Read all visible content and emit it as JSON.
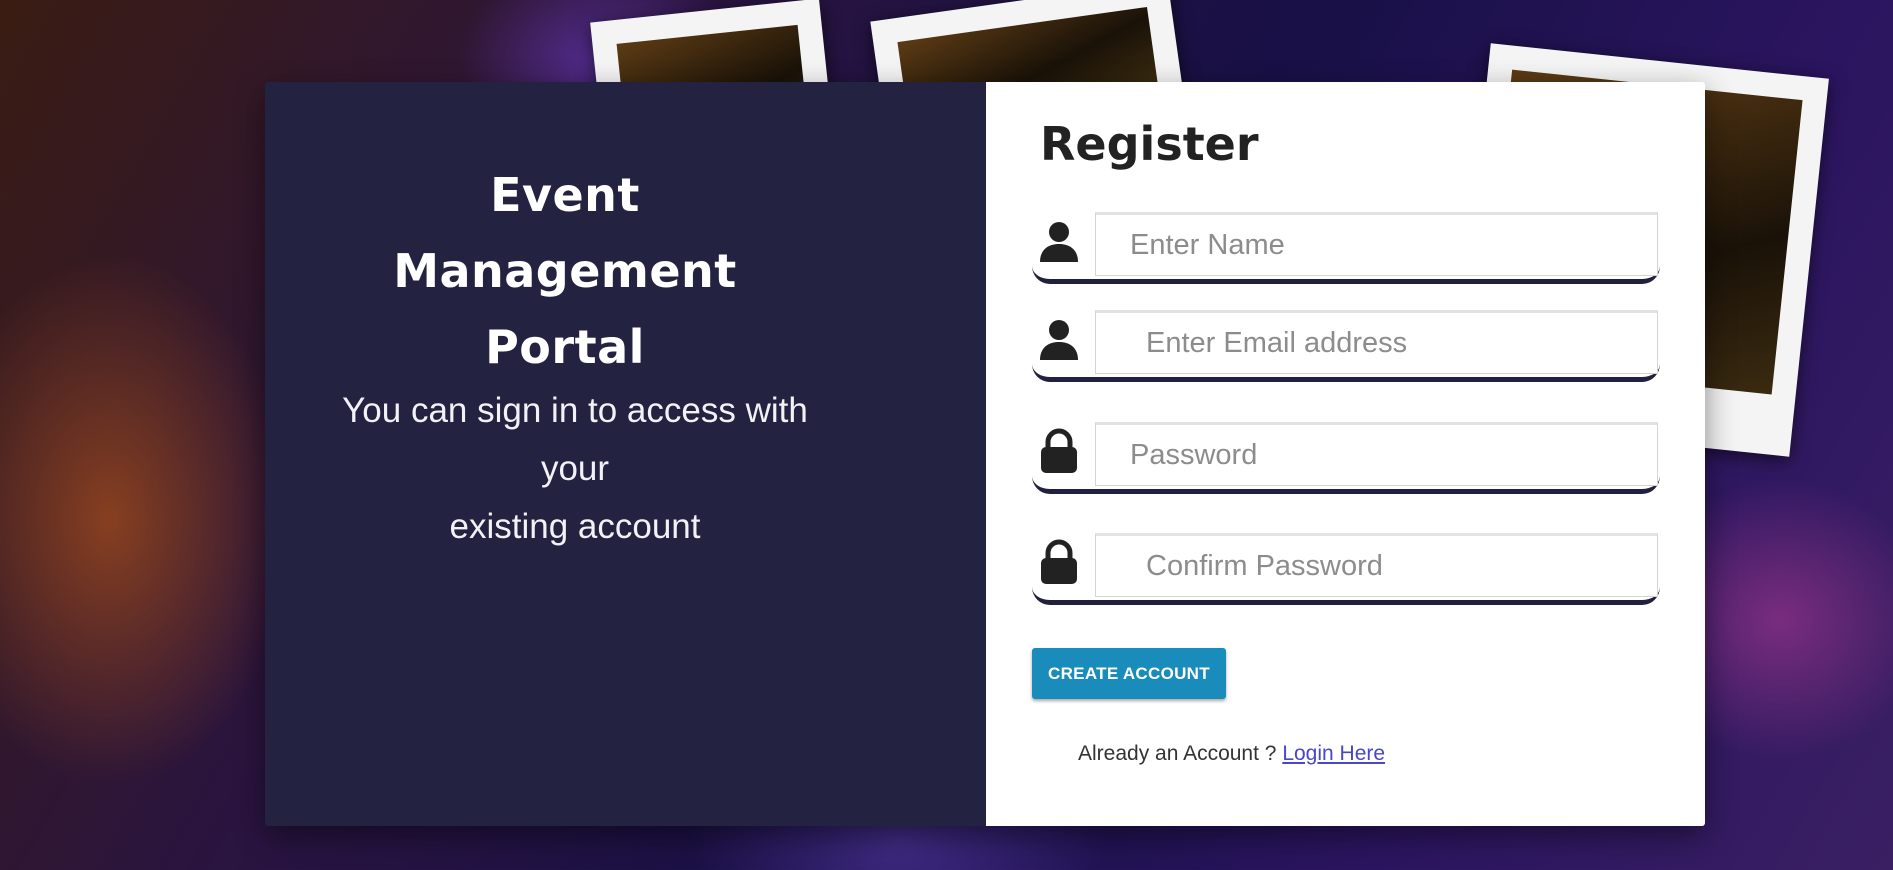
{
  "colors": {
    "left_panel": "#232240",
    "button": "#1a8cbb",
    "link": "#4a46c8",
    "underline": "#22213d"
  },
  "intro": {
    "title_line1": "Event Management",
    "title_line2": "Portal",
    "subtitle_line1": "You can sign in to access with your",
    "subtitle_line2": "existing account"
  },
  "register": {
    "title": "Register",
    "fields": {
      "name": {
        "placeholder": "Enter Name",
        "value": "",
        "icon": "user-icon"
      },
      "email": {
        "placeholder": "Enter Email address",
        "value": "",
        "icon": "user-icon"
      },
      "password": {
        "placeholder": "Password",
        "value": "",
        "icon": "lock-icon"
      },
      "confirm": {
        "placeholder": "Confirm Password",
        "value": "",
        "icon": "lock-icon"
      }
    },
    "create_button": "CREATE ACCOUNT",
    "already_text": "Already an Account ?",
    "login_link": "Login Here"
  }
}
